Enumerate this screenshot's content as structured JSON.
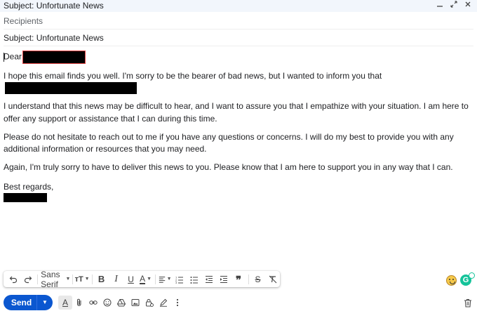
{
  "window": {
    "title": "Subject: Unfortunate News",
    "controls": [
      "minimize-icon",
      "expand-icon",
      "close-icon"
    ]
  },
  "fields": {
    "recipients_placeholder": "Recipients",
    "subject": "Subject: Unfortunate News"
  },
  "body": {
    "greeting": "Dear",
    "p1": "I hope this email finds you well. I'm sorry to be the bearer of bad news, but I wanted to inform you that",
    "p2": "I understand that this news may be difficult to hear, and I want to assure you that I empathize with your situation. I am here to offer any support or assistance that I can during this time.",
    "p3": "Please do not hesitate to reach out to me if you have any questions or concerns. I will do my best to provide you with any additional information or resources that you may need.",
    "p4": "Again, I'm truly sorry to have to deliver this news to you. Please know that I am here to support you in any way that I can.",
    "closing": "Best regards,"
  },
  "format_toolbar": {
    "font": "Sans Serif",
    "icons": [
      "undo-icon",
      "redo-icon",
      "font-size-icon",
      "bold-icon",
      "italic-icon",
      "underline-icon",
      "text-color-icon",
      "align-icon",
      "numbered-list-icon",
      "bulleted-list-icon",
      "indent-less-icon",
      "indent-more-icon",
      "quote-icon",
      "strikethrough-icon",
      "remove-formatting-icon"
    ]
  },
  "bottom_bar": {
    "send_label": "Send",
    "icons": [
      "formatting-options-icon",
      "attach-icon",
      "link-icon",
      "emoji-icon",
      "drive-icon",
      "photo-icon",
      "confidential-icon",
      "signature-icon",
      "more-options-icon",
      "trash-icon"
    ]
  },
  "colors": {
    "send_button": "#0b57d0",
    "titlebar": "#f2f6fc",
    "grammarly": "#15c39a"
  }
}
